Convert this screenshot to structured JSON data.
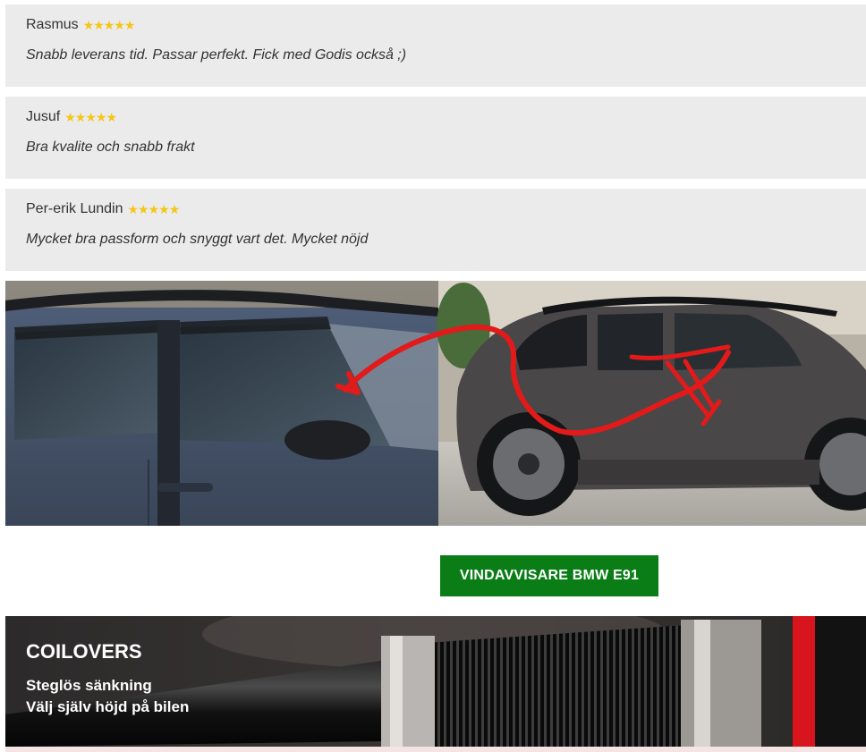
{
  "reviews": [
    {
      "author": "Rasmus",
      "rating": 5,
      "stars": "★★★★★",
      "text": "Snabb leverans tid. Passar perfekt. Fick med Godis också ;)"
    },
    {
      "author": "Jusuf",
      "rating": 5,
      "stars": "★★★★★",
      "text": "Bra kvalite och snabb frakt"
    },
    {
      "author": "Per-erik Lundin",
      "rating": 5,
      "stars": "★★★★★",
      "text": "Mycket bra passform och snyggt vart det. Mycket nöjd"
    }
  ],
  "cta": {
    "label": "VINDAVVISARE BMW E91"
  },
  "coilovers": {
    "title": "COILOVERS",
    "line1": "Steglös sänkning",
    "line2": "Välj själv höjd på bilen"
  },
  "colors": {
    "review_bg": "#ebebeb",
    "star": "#f5c518",
    "cta_bg": "#0a7d17",
    "arrow": "#e21a1a"
  }
}
